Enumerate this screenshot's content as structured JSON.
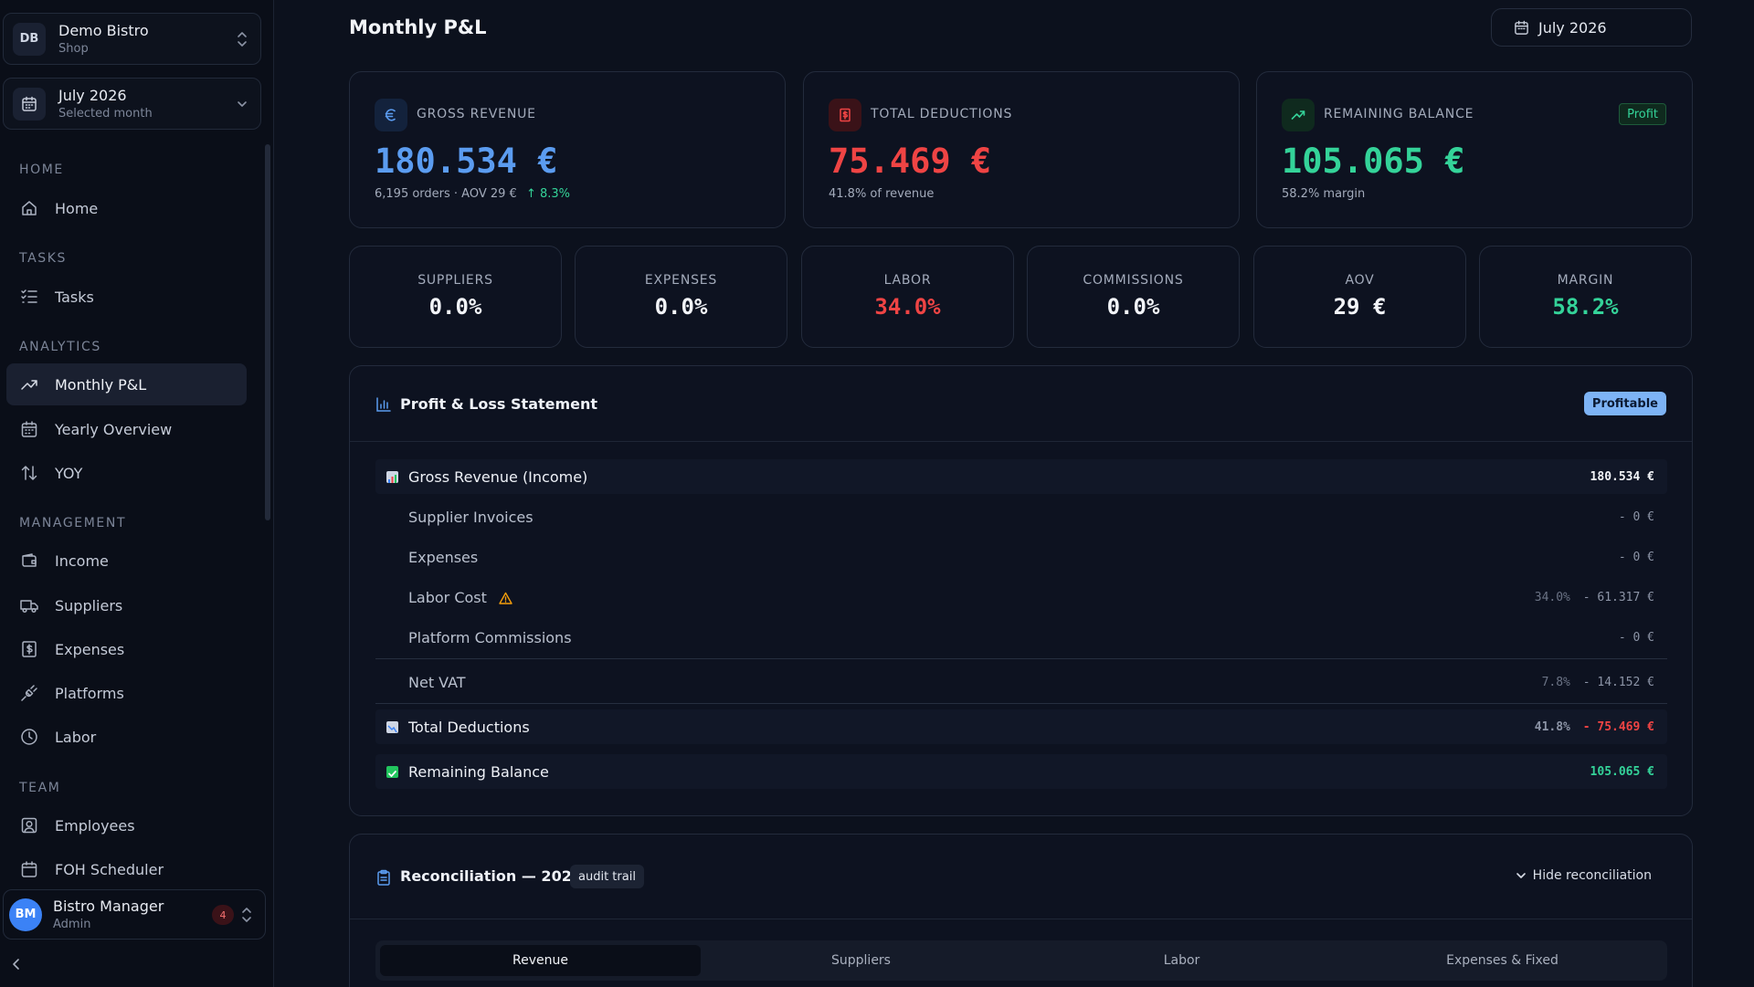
{
  "workspace": {
    "initials": "DB",
    "name": "Demo Bistro",
    "type": "Shop"
  },
  "month_switcher": {
    "label": "July 2026",
    "sub": "Selected month"
  },
  "sidebar": {
    "sections": {
      "home": "HOME",
      "tasks": "TASKS",
      "analytics": "ANALYTICS",
      "management": "MANAGEMENT",
      "team": "TEAM"
    },
    "items": {
      "home": "Home",
      "tasks": "Tasks",
      "monthly_pl": "Monthly P&L",
      "yearly_overview": "Yearly Overview",
      "yoy": "YOY",
      "income": "Income",
      "suppliers": "Suppliers",
      "expenses": "Expenses",
      "platforms": "Platforms",
      "labor": "Labor",
      "employees": "Employees",
      "foh_scheduler": "FOH Scheduler"
    },
    "active_item": "Monthly P&L"
  },
  "user": {
    "initials": "BM",
    "name": "Bistro Manager",
    "role": "Admin",
    "notifications": "4"
  },
  "header": {
    "title": "Monthly P&L",
    "date_picker": "July 2026"
  },
  "kpis": {
    "gross_revenue": {
      "label": "GROSS REVENUE",
      "value": "180.534 €",
      "sub": "6,195 orders · AOV 29 €",
      "change": "↑ 8.3%",
      "color": "#5b9cf0"
    },
    "total_deductions": {
      "label": "TOTAL DEDUCTIONS",
      "value": "75.469 €",
      "sub": "41.8% of revenue",
      "color": "#ef4444"
    },
    "remaining_balance": {
      "label": "REMAINING BALANCE",
      "value": "105.065 €",
      "sub": "58.2% margin",
      "tag": "Profit",
      "color": "#34d399"
    }
  },
  "ratios": {
    "suppliers": {
      "label": "SUPPLIERS",
      "value": "0.0%"
    },
    "expenses": {
      "label": "EXPENSES",
      "value": "0.0%"
    },
    "labor": {
      "label": "LABOR",
      "value": "34.0%",
      "color": "#ef4444"
    },
    "commissions": {
      "label": "COMMISSIONS",
      "value": "0.0%"
    },
    "aov": {
      "label": "AOV",
      "value": "29 €"
    },
    "margin": {
      "label": "MARGIN",
      "value": "58.2%",
      "color": "#34d399"
    }
  },
  "pl_statement": {
    "title": "Profit & Loss Statement",
    "status": "Profitable",
    "rows": {
      "gross_revenue": {
        "name": "Gross Revenue (Income)",
        "amount": "180.534 €"
      },
      "supplier_invoices": {
        "name": "Supplier Invoices",
        "amount": "- 0 €"
      },
      "expenses": {
        "name": "Expenses",
        "amount": "- 0 €"
      },
      "labor_cost": {
        "name": "Labor Cost",
        "pct": "34.0%",
        "amount": "- 61.317 €"
      },
      "platform_commissions": {
        "name": "Platform Commissions",
        "amount": "- 0 €"
      },
      "net_vat": {
        "name": "Net VAT",
        "pct": "7.8%",
        "amount": "- 14.152 €"
      },
      "total_deductions": {
        "name": "Total Deductions",
        "pct": "41.8%",
        "amount": "- 75.469 €"
      },
      "remaining_balance": {
        "name": "Remaining Balance",
        "amount": "105.065 €"
      }
    }
  },
  "reconciliation": {
    "title": "Reconciliation — 2026-07",
    "tag": "audit trail",
    "toggle": "Hide reconciliation",
    "tabs": [
      "Revenue",
      "Suppliers",
      "Labor",
      "Expenses & Fixed"
    ],
    "active_tab": "Revenue"
  }
}
